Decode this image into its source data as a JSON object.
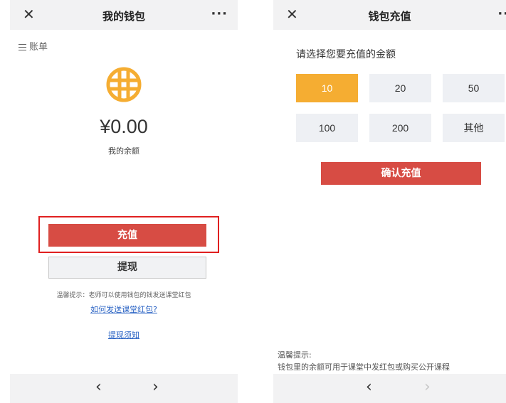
{
  "wallet": {
    "title": "我的钱包",
    "close_icon": "✕",
    "more_icon": "···",
    "bill_label": "账单",
    "balance": "¥0.00",
    "balance_label": "我的余额",
    "recharge_label": "充值",
    "withdraw_label": "提现",
    "tip": "温馨提示：老师可以使用钱包的钱发送课堂红包",
    "link_red_packet": "如何发送课堂红包?",
    "link_withdraw_notice": "提现须知",
    "nav_back": "‹",
    "nav_forward": "›",
    "coin_color": "#f5ad32",
    "highlight_color": "#e02020"
  },
  "recharge": {
    "title": "钱包充值",
    "close_icon": "✕",
    "more_icon": "··",
    "prompt": "请选择您要充值的金额",
    "amounts": [
      "10",
      "20",
      "50",
      "100",
      "200",
      "其他"
    ],
    "selected_amount": "10",
    "confirm_label": "确认充值",
    "note_title": "温馨提示:",
    "note_body": "钱包里的余额可用于课堂中发红包或购买公开课程",
    "nav_back": "‹",
    "nav_forward": "›",
    "selected_color": "#f5ad32",
    "button_color": "#d74c44"
  }
}
